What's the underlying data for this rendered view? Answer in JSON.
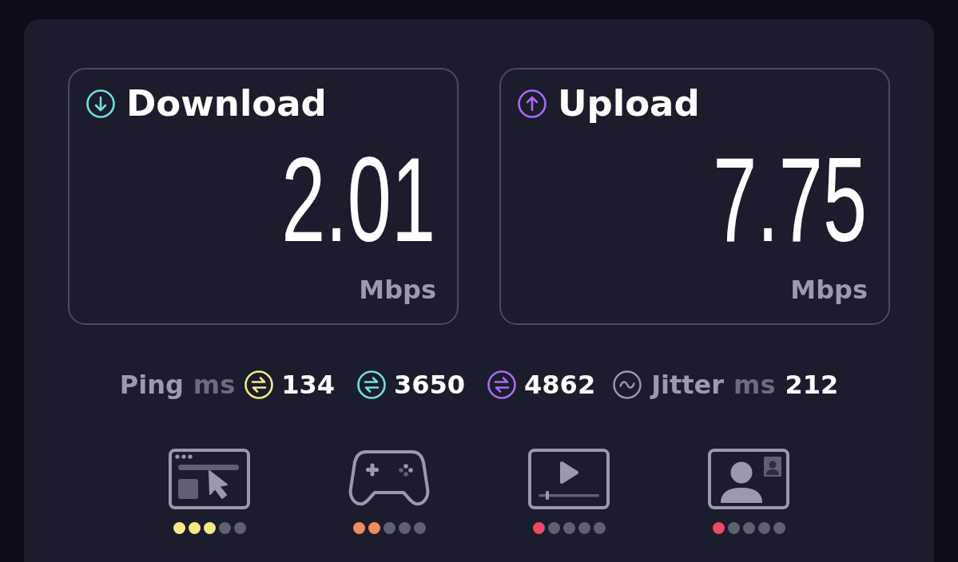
{
  "metrics": [
    {
      "kind": "download",
      "label": "Download",
      "value": "2.01",
      "unit": "Mbps",
      "color": "#6fe0dc"
    },
    {
      "kind": "upload",
      "label": "Upload",
      "value": "7.75",
      "unit": "Mbps",
      "color": "#a86cf0"
    }
  ],
  "ping": {
    "label": "Ping",
    "unit": "ms",
    "readings": [
      {
        "value": "134",
        "color": "#f6e985"
      },
      {
        "value": "3650",
        "color": "#6fe0dc"
      },
      {
        "value": "4862",
        "color": "#a86cf0"
      }
    ]
  },
  "jitter": {
    "label": "Jitter",
    "unit": "ms",
    "value": "212"
  },
  "activities": [
    {
      "kind": "browsing",
      "stars": 3,
      "color": "#f6e985"
    },
    {
      "kind": "gaming",
      "stars": 2,
      "color": "#ef8a66"
    },
    {
      "kind": "streaming",
      "stars": 1,
      "color": "#ef4a63"
    },
    {
      "kind": "video_call",
      "stars": 1,
      "color": "#ef4a63"
    }
  ]
}
